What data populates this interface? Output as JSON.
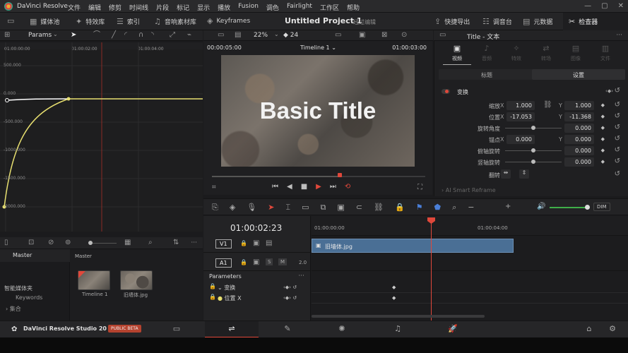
{
  "app": {
    "name": "DaVinci Resolve",
    "studio_label": "DaVinci Resolve Studio 20",
    "badge": "PUBLIC BETA"
  },
  "menu": [
    "文件",
    "编辑",
    "修剪",
    "时间线",
    "片段",
    "标记",
    "显示",
    "播放",
    "Fusion",
    "调色",
    "Fairlight",
    "工作区",
    "帮助"
  ],
  "toolbar": {
    "media_pool": "媒体池",
    "effects": "特效库",
    "index": "索引",
    "sound_library": "音响素材库",
    "keyframes": "Keyframes",
    "project_title": "Untitled Project 1",
    "edit_state": "经过编辑",
    "quick_export": "快捷导出",
    "mixer": "调音台",
    "metadata": "元数据",
    "inspector": "检查器"
  },
  "curve_editor": {
    "mode": "Params",
    "time_marks": [
      "01:00:00:00",
      "01:00:02:00",
      "01:00:04:00"
    ],
    "y_labels": [
      "500.000",
      "0.000",
      "-500.000",
      "-1000.000",
      "-1500.000",
      "-2000.000"
    ]
  },
  "viewer": {
    "zoom": "22%",
    "fps": "24",
    "duration": "00:00:05:00",
    "timeline_name": "Timeline 1",
    "timecode": "01:00:03:00",
    "title_text": "Basic Title",
    "progress": 0.6
  },
  "inspector": {
    "title": "Title - 文本",
    "tabs": [
      "视频",
      "音频",
      "特效",
      "转场",
      "图像",
      "文件"
    ],
    "subtabs": [
      "标题",
      "设置"
    ],
    "section": "变换",
    "zoom_label": "缩放",
    "zoom_x": "1.000",
    "zoom_y": "1.000",
    "position_label": "位置",
    "position_x": "-17.053",
    "position_y": "-11.368",
    "rotation_label": "旋转角度",
    "rotation": "0.000",
    "anchor_label": "锚点",
    "anchor_x": "0.000",
    "anchor_y": "0.000",
    "pitch_label": "俯轴旋转",
    "pitch": "0.000",
    "yaw_label": "竖轴旋转",
    "yaw": "0.000",
    "flip_label": "翻转",
    "next_section": "AI Smart Reframe"
  },
  "timeline": {
    "timecode": "01:00:02:23",
    "ruler_marks": [
      "01:00:00:00",
      "01:00:04:00"
    ],
    "video_track": "V1",
    "audio_track": "A1",
    "audio_channels": "2.0",
    "clip_name": "旧墙体.jpg",
    "dim_label": "DIM",
    "params_header": "Parameters",
    "param_rows": [
      "变换",
      "位置 X"
    ]
  },
  "media_pool": {
    "bin": "Master",
    "bin_header": "Master",
    "smart_bins": "智能媒体夹",
    "keywords": "Keywords",
    "collections": "集合",
    "clips": [
      "Timeline 1",
      "旧墙体.jpg"
    ]
  },
  "colors": {
    "accent_red": "#e0483b",
    "clip_blue": "#4a6f95",
    "curve_yellow": "#e8e070"
  }
}
